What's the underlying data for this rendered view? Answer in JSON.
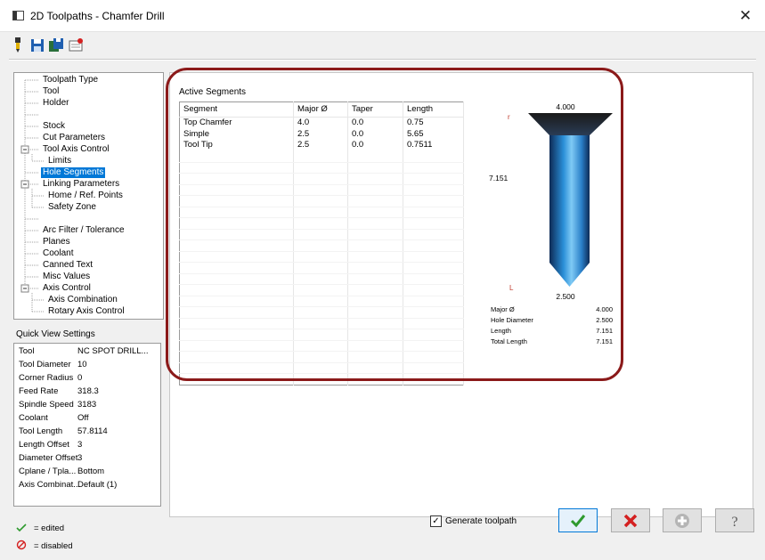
{
  "window": {
    "title": "2D Toolpaths - Chamfer Drill",
    "close_glyph": "✕"
  },
  "toolbar": {
    "icons": [
      "tool-icon",
      "save-icon",
      "save-all-icon",
      "remove-icon"
    ]
  },
  "tree": {
    "items": [
      "Toolpath Type",
      "Tool",
      "Holder",
      "Stock",
      "Cut Parameters",
      "Tool Axis Control",
      "Limits",
      "Hole Segments",
      "Linking Parameters",
      "Home / Ref. Points",
      "Safety Zone",
      "Arc Filter / Tolerance",
      "Planes",
      "Coolant",
      "Canned Text",
      "Misc Values",
      "Axis Control",
      "Axis Combination",
      "Rotary Axis Control"
    ],
    "selected": "Hole Segments"
  },
  "quick_view": {
    "title": "Quick View Settings",
    "rows": [
      {
        "label": "Tool",
        "value": "NC SPOT DRILL..."
      },
      {
        "label": "Tool Diameter",
        "value": "10"
      },
      {
        "label": "Corner Radius",
        "value": "0"
      },
      {
        "label": "Feed Rate",
        "value": "318.3"
      },
      {
        "label": "Spindle Speed",
        "value": "3183"
      },
      {
        "label": "Coolant",
        "value": "Off"
      },
      {
        "label": "Tool Length",
        "value": "57.8114"
      },
      {
        "label": "Length Offset",
        "value": "3"
      },
      {
        "label": "Diameter Offset",
        "value": "3"
      },
      {
        "label": "Cplane / Tpla...",
        "value": "Bottom"
      },
      {
        "label": "Axis Combinat...",
        "value": "Default (1)"
      }
    ]
  },
  "segments": {
    "title": "Active Segments",
    "columns": [
      "Segment",
      "Major Ø",
      "Taper",
      "Length"
    ],
    "rows": [
      [
        "Top Chamfer",
        "4.0",
        "0.0",
        "0.75"
      ],
      [
        "Simple",
        "2.5",
        "0.0",
        "5.65"
      ],
      [
        "Tool Tip",
        "2.5",
        "0.0",
        "0.7511"
      ]
    ]
  },
  "preview": {
    "top_dim": "4.000",
    "side_dim": "7.151",
    "bottom_dim": "2.500",
    "top_marker": "r",
    "bottom_marker": "L",
    "stats": [
      {
        "label": "Major Ø",
        "value": "4.000"
      },
      {
        "label": "Hole Diameter",
        "value": "2.500"
      },
      {
        "label": "Length",
        "value": "7.151"
      },
      {
        "label": "Total Length",
        "value": "7.151"
      }
    ]
  },
  "legend": {
    "edited": "= edited",
    "disabled": "= disabled"
  },
  "footer": {
    "generate_label": "Generate toolpath",
    "generate_checked": true
  },
  "colors": {
    "selection": "#0078d7",
    "highlight": "#8b1a1a",
    "ok": "#2e9a2e",
    "cancel": "#d42020",
    "tool_blue": "#2a8fd8"
  }
}
